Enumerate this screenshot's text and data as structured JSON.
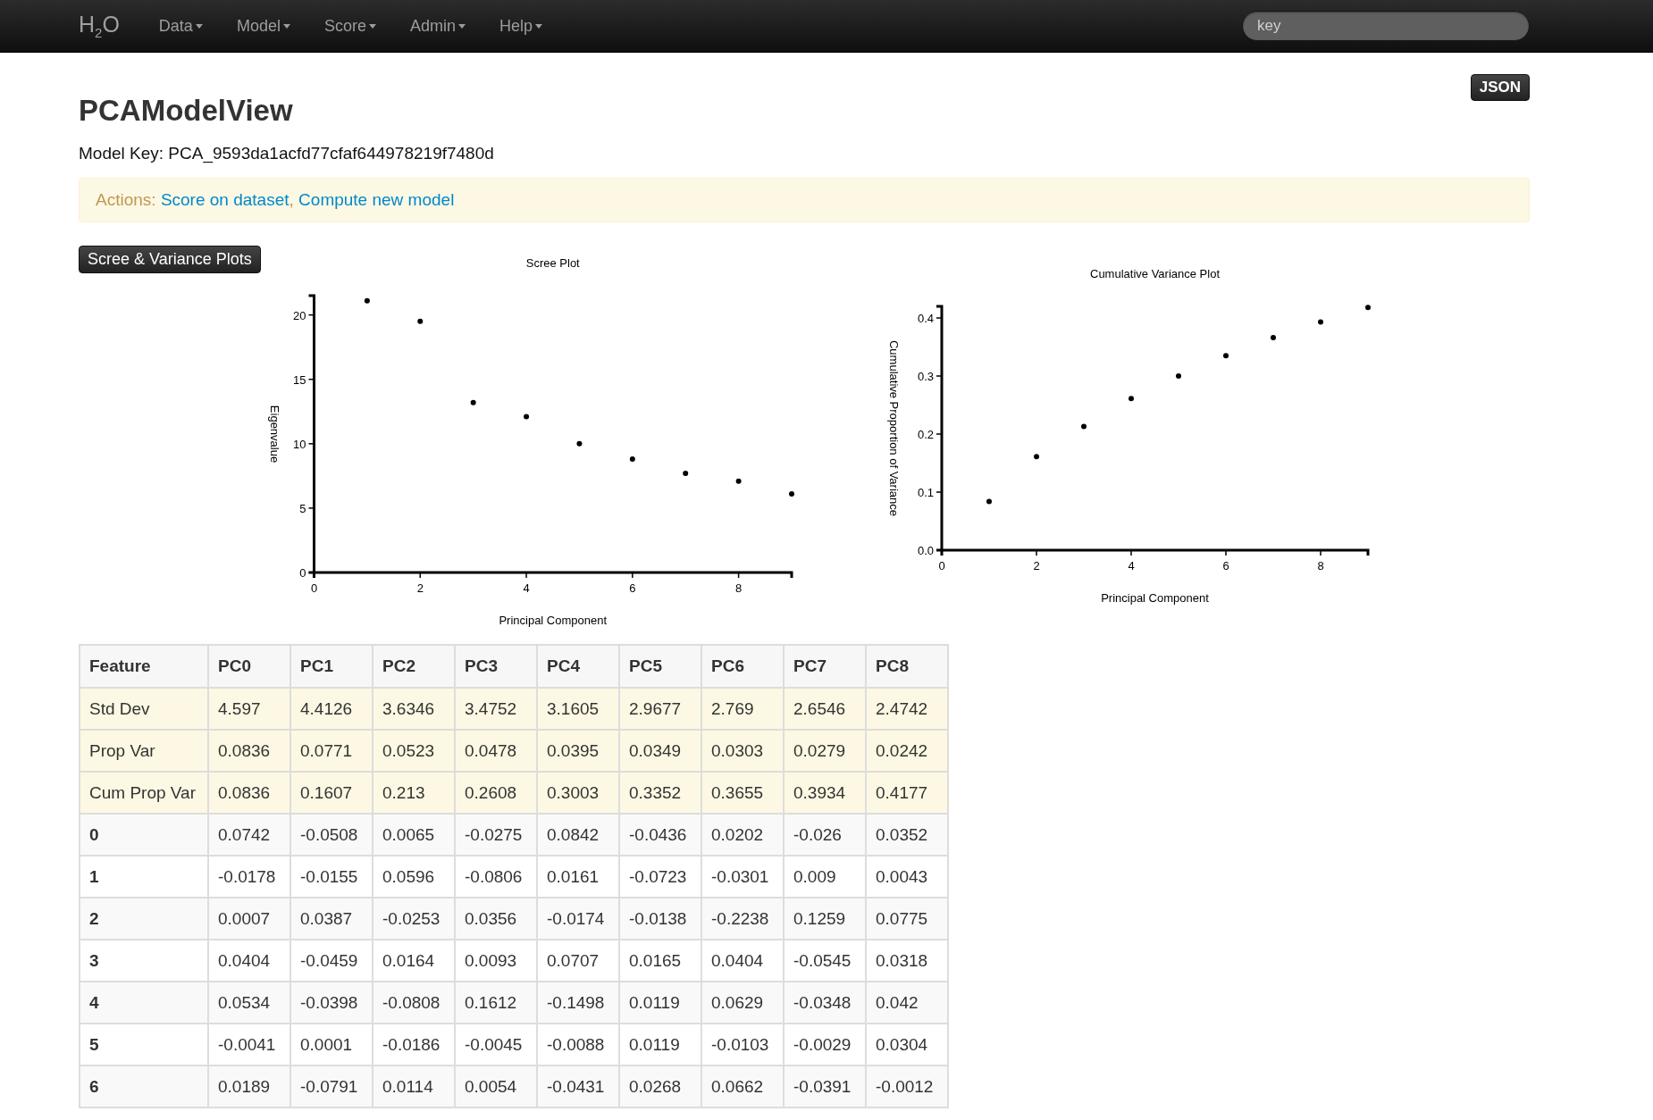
{
  "navbar": {
    "brand": "H$_{2}$O",
    "menus": [
      "Data",
      "Model",
      "Score",
      "Admin",
      "Help"
    ],
    "search": {
      "placeholder": "key"
    }
  },
  "page": {
    "title": "PCAModelView",
    "json_button": "JSON",
    "model_key": "Model Key: PCA_9593da1acfd77cfaf644978219f7480d",
    "actions": {
      "label": "Actions:",
      "links": [
        "Score on dataset",
        "Compute new model"
      ],
      "separator": ","
    }
  },
  "plots": {
    "button": "Scree & Variance Plots",
    "scree": {
      "chart_data": {
        "type": "scatter",
        "title": "Scree Plot",
        "xlabel": "Principal Component",
        "ylabel": "Eigenvalue",
        "xlim": [
          0,
          9
        ],
        "ylim": [
          0,
          21.5
        ],
        "xticks": [
          0,
          2,
          4,
          6,
          8
        ],
        "yticks": [
          0,
          5,
          10,
          15,
          20
        ],
        "series": [
          {
            "color": "#000000",
            "x": [
              1,
              2,
              3,
              4,
              5,
              6,
              7,
              8,
              9
            ],
            "values": [
              21.1,
              19.5,
              13.2,
              12.1,
              10,
              8.8,
              7.7,
              7.1,
              6.1
            ]
          }
        ]
      }
    },
    "variance": {
      "chart_data": {
        "type": "scatter",
        "title": "Cumulative Variance Plot",
        "xlabel": "Principal Component",
        "ylabel": "Cumulative Proportion of Variance",
        "xlim": [
          0,
          9
        ],
        "ylim": [
          0,
          0.42
        ],
        "xticks": [
          0,
          2,
          4,
          6,
          8
        ],
        "yticks": [
          {
            "value": 0,
            "label": "0.0"
          },
          {
            "value": 0.1,
            "label": "0.1"
          },
          {
            "value": 0.2,
            "label": "0.2"
          },
          {
            "value": 0.3,
            "label": "0.3"
          },
          {
            "value": 0.4,
            "label": "0.4"
          }
        ],
        "series": [
          {
            "color": "#000000",
            "x": [
              1,
              2,
              3,
              4,
              5,
              6,
              7,
              8,
              9
            ],
            "values": [
              0.084,
              0.161,
              0.213,
              0.261,
              0.3,
              0.335,
              0.366,
              0.393,
              0.418
            ]
          }
        ]
      }
    }
  },
  "table": {
    "columns": [
      "Feature",
      "PC0",
      "PC1",
      "PC2",
      "PC3",
      "PC4",
      "PC5",
      "PC6",
      "PC7",
      "PC8"
    ],
    "rows": [
      {
        "kind": "stat",
        "cells": [
          "Std Dev",
          "4.597",
          "4.4126",
          "3.6346",
          "3.4752",
          "3.1605",
          "2.9677",
          "2.769",
          "2.6546",
          "2.4742"
        ]
      },
      {
        "kind": "stat",
        "cells": [
          "Prop Var",
          "0.0836",
          "0.0771",
          "0.0523",
          "0.0478",
          "0.0395",
          "0.0349",
          "0.0303",
          "0.0279",
          "0.0242"
        ]
      },
      {
        "kind": "stat",
        "cells": [
          "Cum Prop Var",
          "0.0836",
          "0.1607",
          "0.213",
          "0.2608",
          "0.3003",
          "0.3352",
          "0.3655",
          "0.3934",
          "0.4177"
        ]
      },
      {
        "kind": "feature",
        "cells": [
          "0",
          "0.0742",
          "-0.0508",
          "0.0065",
          "-0.0275",
          "0.0842",
          "-0.0436",
          "0.0202",
          "-0.026",
          "0.0352"
        ]
      },
      {
        "kind": "feature",
        "cells": [
          "1",
          "-0.0178",
          "-0.0155",
          "0.0596",
          "-0.0806",
          "0.0161",
          "-0.0723",
          "-0.0301",
          "0.009",
          "0.0043"
        ]
      },
      {
        "kind": "feature",
        "cells": [
          "2",
          "0.0007",
          "0.0387",
          "-0.0253",
          "0.0356",
          "-0.0174",
          "-0.0138",
          "-0.2238",
          "0.1259",
          "0.0775"
        ]
      },
      {
        "kind": "feature",
        "cells": [
          "3",
          "0.0404",
          "-0.0459",
          "0.0164",
          "0.0093",
          "0.0707",
          "0.0165",
          "0.0404",
          "-0.0545",
          "0.0318"
        ]
      },
      {
        "kind": "feature",
        "cells": [
          "4",
          "0.0534",
          "-0.0398",
          "-0.0808",
          "0.1612",
          "-0.1498",
          "0.0119",
          "0.0629",
          "-0.0348",
          "0.042"
        ]
      },
      {
        "kind": "feature",
        "cells": [
          "5",
          "-0.0041",
          "0.0001",
          "-0.0186",
          "-0.0045",
          "-0.0088",
          "0.0119",
          "-0.0103",
          "-0.0029",
          "0.0304"
        ]
      },
      {
        "kind": "feature",
        "cells": [
          "6",
          "0.0189",
          "-0.0791",
          "0.0114",
          "0.0054",
          "-0.0431",
          "0.0268",
          "0.0662",
          "-0.0391",
          "-0.0012"
        ]
      }
    ]
  }
}
